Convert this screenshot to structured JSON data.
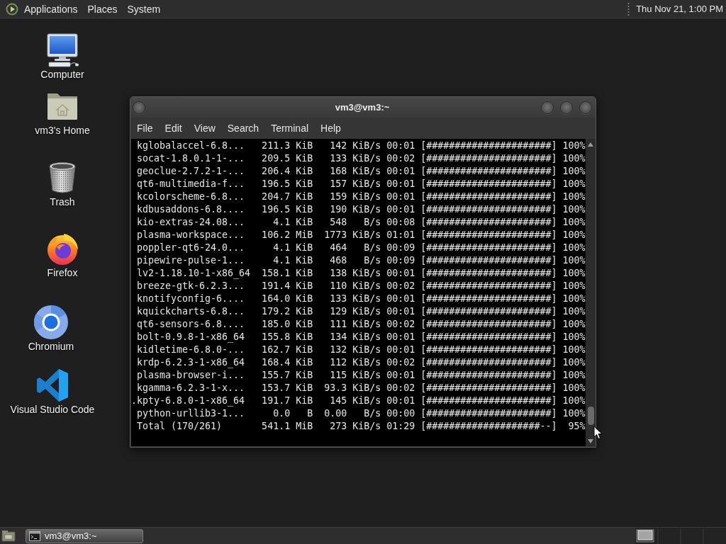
{
  "top_panel": {
    "menus": [
      "Applications",
      "Places",
      "System"
    ],
    "clock": "Thu Nov 21, 1:00 PM"
  },
  "desktop_icons": [
    {
      "label": "Computer",
      "kind": "computer"
    },
    {
      "label": "vm3's Home",
      "kind": "home"
    },
    {
      "label": "Trash",
      "kind": "trash"
    },
    {
      "label": "Firefox",
      "kind": "firefox"
    },
    {
      "label": "Chromium",
      "kind": "chromium"
    },
    {
      "label": "Visual Studio Code",
      "kind": "vscode"
    }
  ],
  "terminal_window": {
    "title": "vm3@vm3:~",
    "menu": [
      "File",
      "Edit",
      "View",
      "Search",
      "Terminal",
      "Help"
    ],
    "lines": [
      " kglobalaccel-6.8...   211.3 KiB   142 KiB/s 00:01 [######################] 100%",
      " socat-1.8.0.1-1-...   209.5 KiB   133 KiB/s 00:02 [######################] 100%",
      " geoclue-2.7.2-1-...   206.4 KiB   168 KiB/s 00:01 [######################] 100%",
      " qt6-multimedia-f...   196.5 KiB   157 KiB/s 00:01 [######################] 100%",
      " kcolorscheme-6.8...   204.7 KiB   159 KiB/s 00:01 [######################] 100%",
      " kdbusaddons-6.8....   196.5 KiB   190 KiB/s 00:01 [######################] 100%",
      " kio-extras-24.08...     4.1 KiB   548   B/s 00:08 [######################] 100%",
      " plasma-workspace...   106.2 MiB  1773 KiB/s 01:01 [######################] 100%",
      " poppler-qt6-24.0...     4.1 KiB   464   B/s 00:09 [######################] 100%",
      " pipewire-pulse-1...     4.1 KiB   468   B/s 00:09 [######################] 100%",
      " lv2-1.18.10-1-x86_64  158.1 KiB   138 KiB/s 00:01 [######################] 100%",
      " breeze-gtk-6.2.3...   191.4 KiB   110 KiB/s 00:02 [######################] 100%",
      " knotifyconfig-6....   164.0 KiB   133 KiB/s 00:01 [######################] 100%",
      " kquickcharts-6.8...   179.2 KiB   129 KiB/s 00:01 [######################] 100%",
      " qt6-sensors-6.8....   185.0 KiB   111 KiB/s 00:02 [######################] 100%",
      " bolt-0.9.8-1-x86_64   155.8 KiB   134 KiB/s 00:01 [######################] 100%",
      " kidletime-6.8.0-...   162.7 KiB   132 KiB/s 00:01 [######################] 100%",
      " krdp-6.2.3-1-x86_64   168.4 KiB   112 KiB/s 00:02 [######################] 100%",
      " plasma-browser-i...   155.7 KiB   115 KiB/s 00:01 [######################] 100%",
      " kgamma-6.2.3-1-x...   153.7 KiB  93.3 KiB/s 00:02 [######################] 100%",
      ".kpty-6.8.0-1-x86_64   191.7 KiB   145 KiB/s 00:01 [######################] 100%",
      " python-urllib3-1...     0.0   B  0.00   B/s 00:00 [######################] 100%",
      " Total (170/261)       541.1 MiB   273 KiB/s 01:29 [####################--]  95%"
    ]
  },
  "taskbar": {
    "tasks": [
      {
        "label": "vm3@vm3:~",
        "selected": true
      }
    ]
  }
}
